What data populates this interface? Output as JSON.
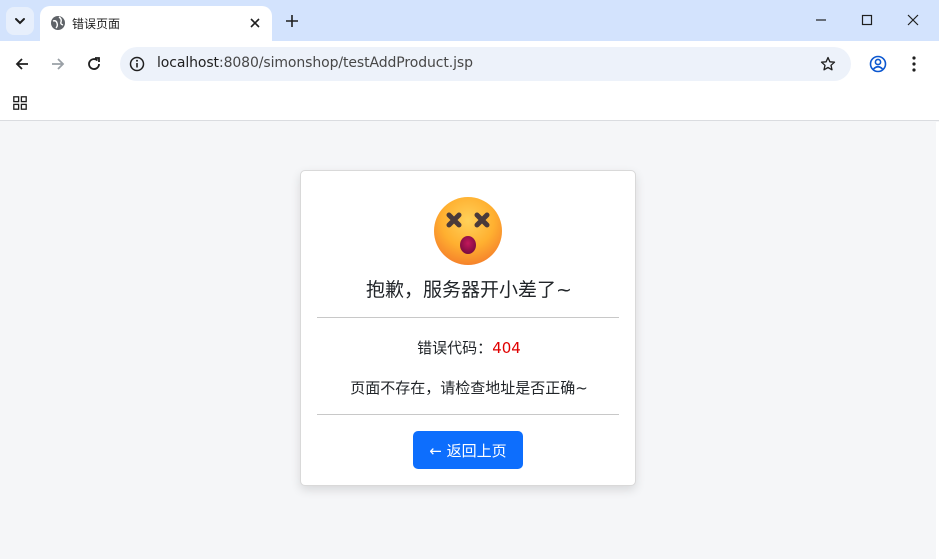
{
  "browser": {
    "tab_title": "错误页面",
    "url_host": "localhost",
    "url_rest": ":8080/simonshop/testAddProduct.jsp"
  },
  "icons": {
    "tab_menu": "chevron-down-icon",
    "favicon": "globe-icon",
    "close": "close-icon",
    "new_tab": "plus-icon",
    "minimize": "minimize-icon",
    "maximize": "maximize-icon",
    "window_close": "close-icon",
    "back": "arrow-left-icon",
    "forward": "arrow-right-icon",
    "reload": "reload-icon",
    "site_info": "info-icon",
    "bookmark": "star-icon",
    "profile": "profile-icon",
    "menu": "kebab-menu-icon",
    "apps": "apps-grid-icon",
    "error_emoji": "dizzy-face-emoji"
  },
  "error_card": {
    "headline": "抱歉，服务器开小差了~",
    "code_label": "错误代码：",
    "code_value": "404",
    "message": "页面不存在，请检查地址是否正确~",
    "back_button": "← 返回上页"
  },
  "colors": {
    "tabbar": "#d3e3fd",
    "button_primary": "#0d6efd",
    "error_code": "#e00000",
    "page_bg": "#f5f6f8"
  }
}
